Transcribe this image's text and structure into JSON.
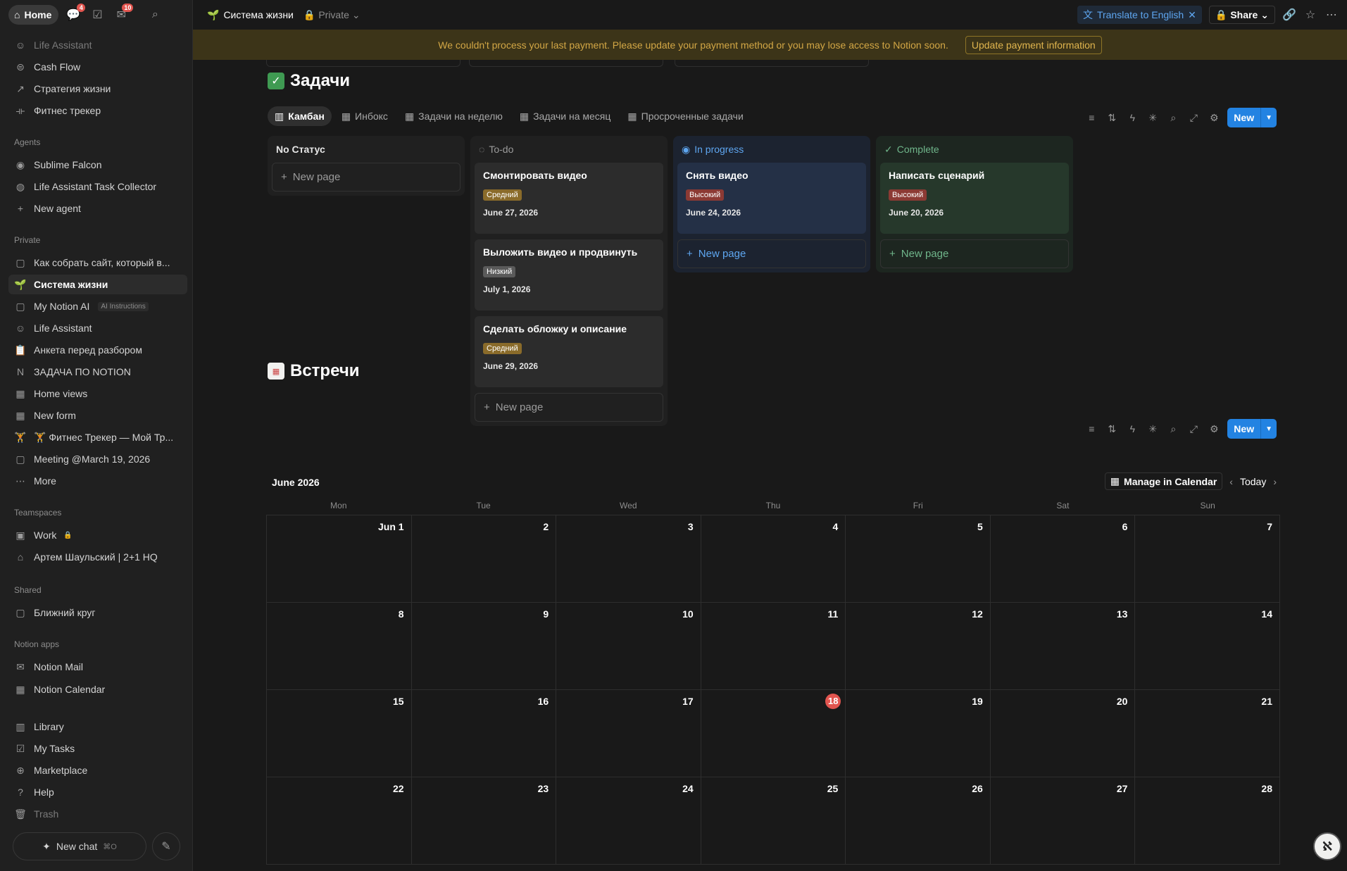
{
  "sidebar": {
    "home_label": "Home",
    "badges": {
      "chat": "4",
      "inbox": "10"
    },
    "top_items": [
      {
        "label": "Life Assistant",
        "icon": "smile-icon"
      },
      {
        "label": "Cash Flow",
        "icon": "money-icon"
      },
      {
        "label": "Стратегия жизни",
        "icon": "arrow-icon"
      },
      {
        "label": "Фитнес трекер",
        "icon": "dumbbell-icon"
      }
    ],
    "agents_header": "Agents",
    "agents": [
      {
        "label": "Sublime Falcon",
        "icon": "falcon-icon"
      },
      {
        "label": "Life Assistant Task Collector",
        "icon": "agent-icon"
      },
      {
        "label": "New agent",
        "icon": "plus-icon"
      }
    ],
    "private_header": "Private",
    "private_items": [
      {
        "label": "Как собрать сайт, который в...",
        "icon": "page-icon"
      },
      {
        "label": "Система жизни",
        "icon": "sprout-icon",
        "active": true
      },
      {
        "label": "My Notion AI",
        "icon": "page-icon",
        "tag": "AI Instructions"
      },
      {
        "label": "Life Assistant",
        "icon": "smile-icon"
      },
      {
        "label": "Анкета перед разбором",
        "icon": "clipboard-icon"
      },
      {
        "label": "ЗАДАЧА ПО NOTION",
        "icon": "notion-icon"
      },
      {
        "label": "Home views",
        "icon": "table-icon"
      },
      {
        "label": "New form",
        "icon": "table-icon"
      },
      {
        "label": "🏋️ Фитнес Трекер — Мой Тр...",
        "icon": "lifter-icon"
      },
      {
        "label": "Meeting @March 19, 2026",
        "icon": "page-icon"
      },
      {
        "label": "More",
        "icon": "dots-icon"
      }
    ],
    "teamspaces_header": "Teamspaces",
    "teamspaces": [
      {
        "label": "Work",
        "icon": "work-icon",
        "locked": true
      },
      {
        "label": "Артем Шаульский | 2+1 HQ",
        "icon": "hq-icon"
      }
    ],
    "shared_header": "Shared",
    "shared": [
      {
        "label": "Ближний круг",
        "icon": "page-icon"
      }
    ],
    "apps_header": "Notion apps",
    "apps": [
      {
        "label": "Notion Mail",
        "icon": "mail-icon"
      },
      {
        "label": "Notion Calendar",
        "icon": "calendar-icon"
      }
    ],
    "bottom_items": [
      {
        "label": "Library",
        "icon": "library-icon"
      },
      {
        "label": "My Tasks",
        "icon": "checkbox-icon"
      },
      {
        "label": "Marketplace",
        "icon": "marketplace-icon"
      },
      {
        "label": "Help",
        "icon": "help-icon"
      },
      {
        "label": "Trash",
        "icon": "trash-icon"
      }
    ],
    "new_chat": "New chat",
    "new_chat_kbd": "⌘O"
  },
  "topbar": {
    "page_title": "Система жизни",
    "privacy": "Private",
    "translate": "Translate to English",
    "share": "Share"
  },
  "banner": {
    "message": "We couldn't process your last payment. Please update your payment method or you may lose access to Notion soon.",
    "button": "Update payment information"
  },
  "tasks": {
    "title": "Задачи",
    "tabs": [
      "Камбан",
      "Инбокс",
      "Задачи на неделю",
      "Задачи на месяц",
      "Просроченные задачи"
    ],
    "new_label": "New",
    "new_page_label": "New page",
    "columns": [
      {
        "title": "No Статус",
        "color": "#e6e6e6",
        "bg": "#202020",
        "cards": []
      },
      {
        "title": "To-do",
        "color": "#9b9b9b",
        "bg": "#202020",
        "cards": [
          {
            "title": "Смонтировать видео",
            "priority": "Средний",
            "priority_color": "#8a6b2a",
            "date": "June 27, 2026"
          },
          {
            "title": "Выложить видео и продвинуть",
            "priority": "Низкий",
            "priority_color": "#5a5a5a",
            "date": "July 1, 2026"
          },
          {
            "title": "Сделать обложку и описание",
            "priority": "Средний",
            "priority_color": "#8a6b2a",
            "date": "June 29, 2026"
          }
        ]
      },
      {
        "title": "In progress",
        "color": "#5ea6f0",
        "bg": "#1c2330",
        "cards": [
          {
            "title": "Снять видео",
            "priority": "Высокий",
            "priority_color": "#8c3a34",
            "date": "June 24, 2026"
          }
        ]
      },
      {
        "title": "Complete",
        "color": "#6fb58a",
        "bg": "#1d2620",
        "cards": [
          {
            "title": "Написать сценарий",
            "priority": "Высокий",
            "priority_color": "#8c3a34",
            "date": "June 20, 2026"
          }
        ]
      }
    ]
  },
  "meetings": {
    "title": "Встречи",
    "month": "June 2026",
    "manage": "Manage in Calendar",
    "today": "Today",
    "new_label": "New",
    "weekdays": [
      "Mon",
      "Tue",
      "Wed",
      "Thu",
      "Fri",
      "Sat",
      "Sun"
    ],
    "weeks": [
      [
        "Jun 1",
        "2",
        "3",
        "4",
        "5",
        "6",
        "7"
      ],
      [
        "8",
        "9",
        "10",
        "11",
        "12",
        "13",
        "14"
      ],
      [
        "15",
        "16",
        "17",
        "18",
        "19",
        "20",
        "21"
      ],
      [
        "22",
        "23",
        "24",
        "25",
        "26",
        "27",
        "28"
      ]
    ],
    "today_date": "18"
  },
  "colors": {
    "accent": "#2383e2",
    "banner_text": "#d3a745",
    "today": "#e2554f"
  }
}
